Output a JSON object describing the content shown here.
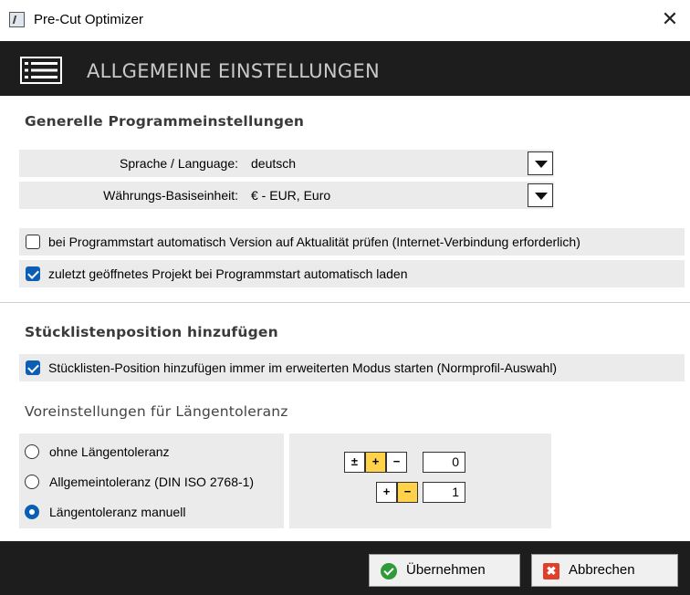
{
  "window": {
    "title": "Pre-Cut Optimizer",
    "close_symbol": "✕"
  },
  "header": {
    "title": "ALLGEMEINE EINSTELLUNGEN",
    "icon": "list-icon"
  },
  "general": {
    "title": "Generelle Programmeinstellungen",
    "language": {
      "label": "Sprache / Language:",
      "value": "deutsch"
    },
    "currency": {
      "label": "Währungs-Basiseinheit:",
      "value": "€ - EUR, Euro"
    },
    "check_version": {
      "label": "bei Programmstart automatisch Version auf Aktualität prüfen (Internet-Verbindung erforderlich)",
      "checked": false
    },
    "load_last_project": {
      "label": "zuletzt geöffnetes Projekt bei Programmstart automatisch laden",
      "checked": true
    }
  },
  "bom": {
    "title": "Stücklistenposition hinzufügen",
    "extended_mode": {
      "label": "Stücklisten-Position hinzufügen immer im erweiterten Modus starten (Normprofil-Auswahl)",
      "checked": true
    }
  },
  "tolerance": {
    "title": "Voreinstellungen für Längentoleranz",
    "options": [
      {
        "label": "ohne Längentoleranz",
        "selected": false
      },
      {
        "label": "Allgemeintoleranz (DIN ISO 2768-1)",
        "selected": false
      },
      {
        "label": "Längentoleranz manuell",
        "selected": true
      }
    ],
    "buttons": {
      "plusminus": "±",
      "plus": "+",
      "minus": "−"
    },
    "upper_value": "0",
    "lower_value": "1"
  },
  "footer": {
    "ok_label": "Übernehmen",
    "cancel_label": "Abbrechen",
    "cancel_glyph": "✖"
  },
  "colors": {
    "dark": "#1d1d1d",
    "accent": "#0a5fb4",
    "highlight": "#ffd24a",
    "row_bg": "#ebebeb"
  }
}
